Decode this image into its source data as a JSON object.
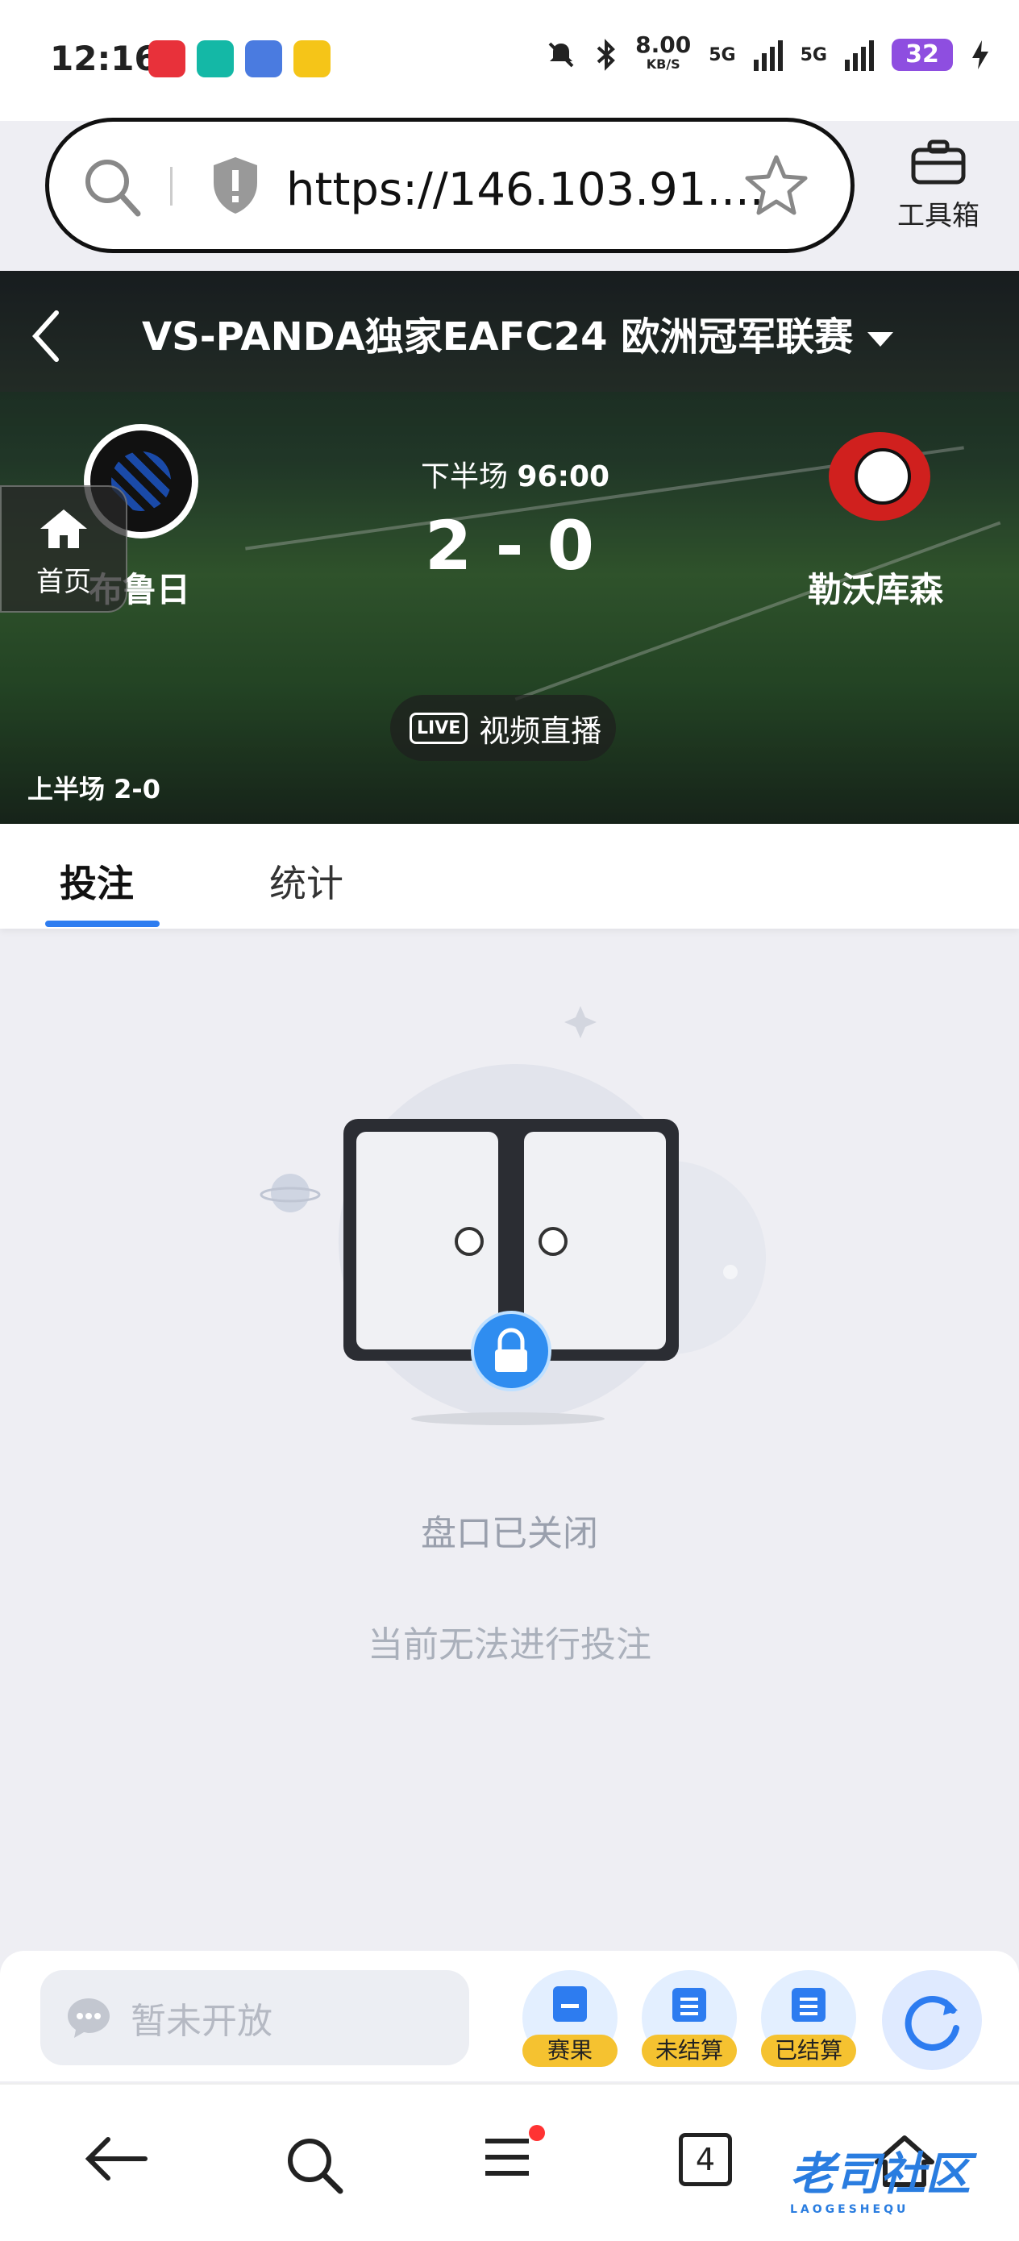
{
  "status_bar": {
    "time": "12:16",
    "net_speed": "8.00",
    "net_speed_unit": "KB/S",
    "signal1": "5G",
    "signal2": "5G",
    "battery": "32",
    "app_icons": [
      "app-1-icon",
      "boss-icon",
      "game-icon",
      "app-4-icon"
    ]
  },
  "browser": {
    "url": "https://146.103.91....",
    "toolbox_label": "工具箱"
  },
  "match": {
    "title": "VS-PANDA独家EAFC24 欧洲冠军联赛",
    "home_team": "布鲁日",
    "away_team": "勒沃库森",
    "period_label": "下半场",
    "clock": "96:00",
    "score": "2 - 0",
    "live_tag": "LIVE",
    "live_label": "视频直播",
    "half_time": "上半场 2-0",
    "home_float_label": "首页"
  },
  "tabs": [
    {
      "label": "投注",
      "active": true
    },
    {
      "label": "统计",
      "active": false
    }
  ],
  "empty_state": {
    "title": "盘口已关闭",
    "subtitle": "当前无法进行投注"
  },
  "action_bar": {
    "chat_placeholder": "暂未开放",
    "results_label": "赛果",
    "unsettled_label": "未结算",
    "settled_label": "已结算"
  },
  "nav_bar": {
    "tab_count": "4"
  },
  "watermark": {
    "text": "老司社区",
    "sub": "LAOGESHEQU"
  },
  "colors": {
    "accent": "#2d7cf0",
    "badge": "#f5c230",
    "battery": "#8e4ee0"
  }
}
